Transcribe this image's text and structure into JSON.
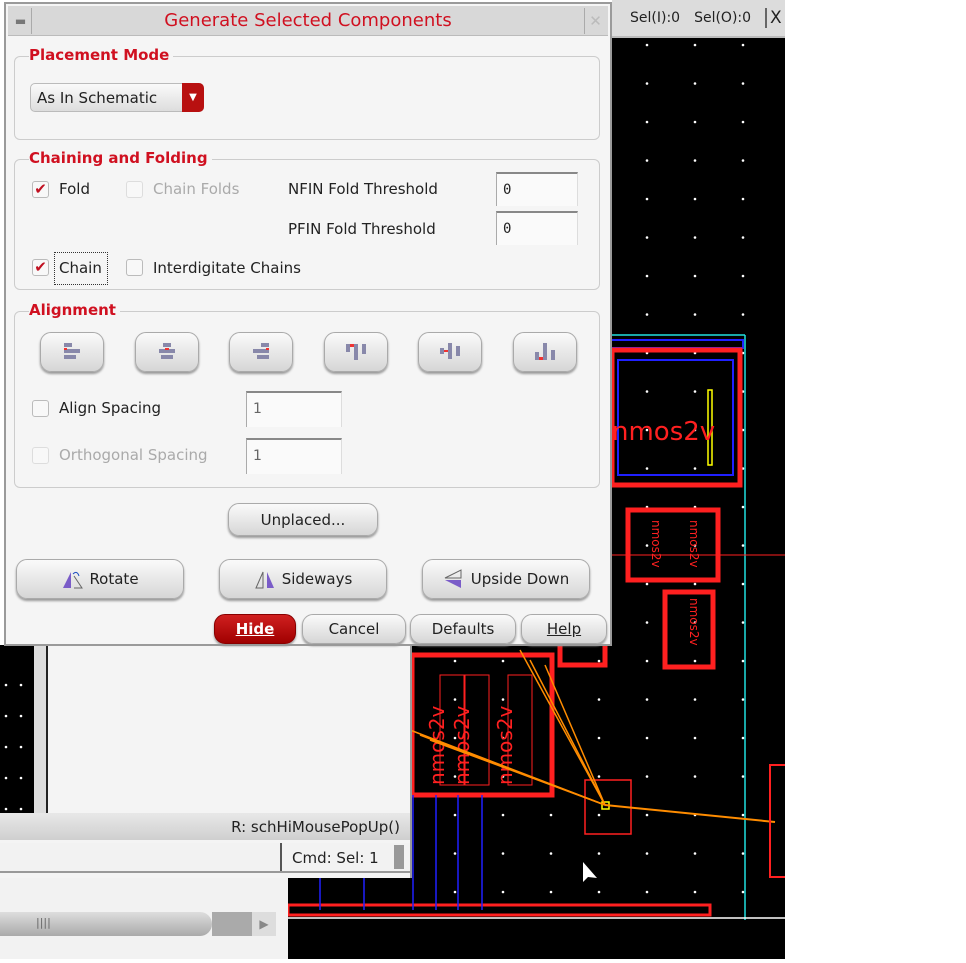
{
  "dialog": {
    "title": "Generate Selected Components",
    "placement_mode": {
      "title": "Placement Mode",
      "selected": "As In Schematic"
    },
    "chaining_folding": {
      "title": "Chaining and Folding",
      "fold": {
        "label": "Fold",
        "checked": true
      },
      "chain_folds": {
        "label": "Chain Folds",
        "checked": false,
        "enabled": false
      },
      "nfin_label": "NFIN Fold Threshold",
      "nfin_value": "0",
      "pfin_label": "PFIN Fold Threshold",
      "pfin_value": "0",
      "chain": {
        "label": "Chain",
        "checked": true
      },
      "interdigitate": {
        "label": "Interdigitate Chains",
        "checked": false
      }
    },
    "alignment": {
      "title": "Alignment",
      "buttons": [
        "align-left",
        "align-center-horizontal",
        "align-right",
        "align-top",
        "align-center-vertical",
        "align-bottom"
      ],
      "align_spacing": {
        "label": "Align Spacing",
        "checked": false,
        "value": "1"
      },
      "orthogonal_spacing": {
        "label": "Orthogonal Spacing",
        "checked": false,
        "enabled": false,
        "value": "1"
      }
    },
    "unplaced_label": "Unplaced...",
    "rotate_label": "Rotate",
    "sideways_label": "Sideways",
    "upside_down_label": "Upside Down",
    "hide_label": "Hide",
    "cancel_label": "Cancel",
    "defaults_label": "Defaults",
    "help_label": "Help",
    "check_mark": "✔"
  },
  "topbar": {
    "sel_i": "Sel(I):0",
    "sel_o": "Sel(O):0",
    "close": "X"
  },
  "status": {
    "mouse": "R: schHiMousePopUp()",
    "cmd": "Cmd: Sel: 1"
  },
  "canvas": {
    "instance_label": "nmos2v"
  },
  "colors": {
    "accent": "#d01020",
    "canvas_bg": "#000000",
    "layout_red": "#ff2020",
    "layout_blue": "#2020ff",
    "layout_cyan": "#20e0e0",
    "wire_orange": "#ff8c00"
  }
}
